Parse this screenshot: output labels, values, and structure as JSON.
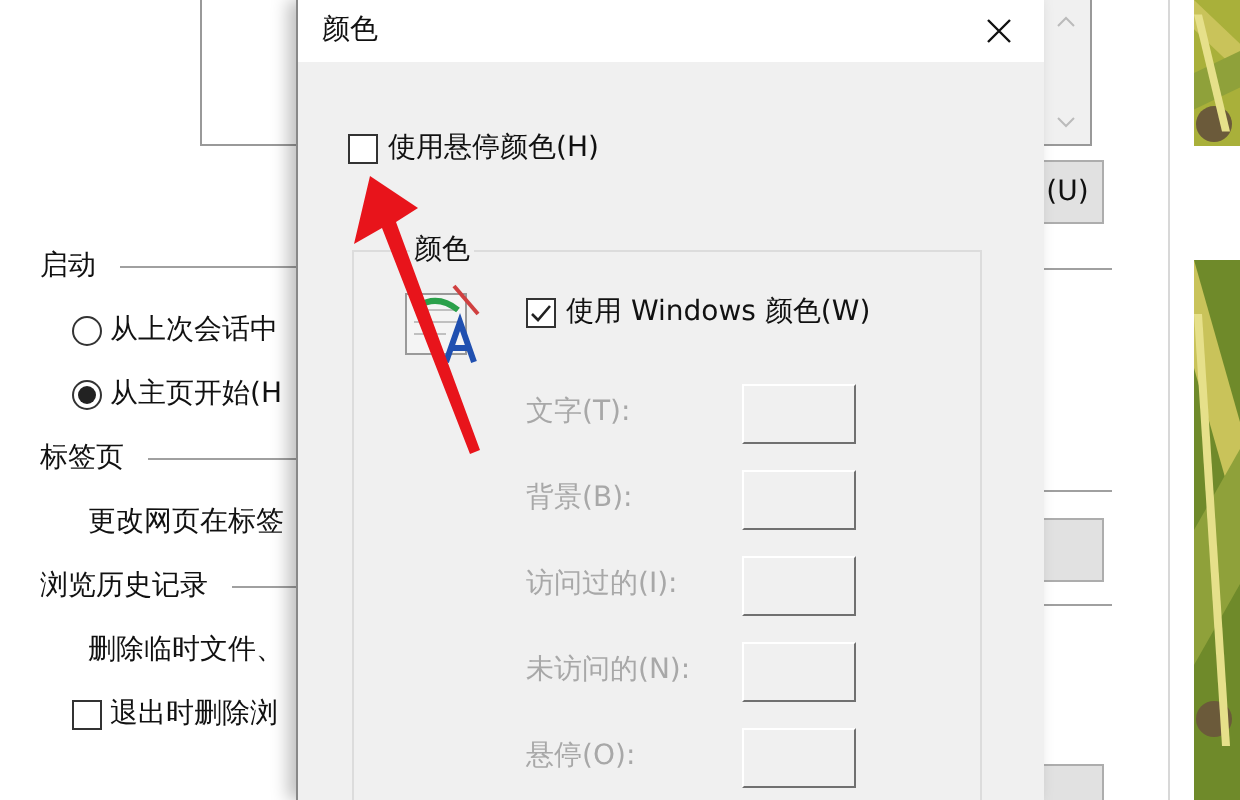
{
  "background_window": {
    "side_button": "(U)",
    "sections": [
      {
        "title": "启动",
        "items": [
          {
            "kind": "radio",
            "label": "从上次会话中",
            "selected": false
          },
          {
            "kind": "radio",
            "label": "从主页开始(H",
            "selected": true
          }
        ]
      },
      {
        "title": "标签页",
        "items": [
          {
            "kind": "text",
            "label": "更改网页在标签"
          }
        ]
      },
      {
        "title": "浏览历史记录",
        "items": [
          {
            "kind": "text",
            "label": "删除临时文件、"
          },
          {
            "kind": "checkbox",
            "label": "退出时删除浏",
            "checked": false
          }
        ]
      }
    ]
  },
  "dialog": {
    "title": "颜色",
    "hover_checkbox": {
      "label": "使用悬停颜色(H)",
      "checked": false
    },
    "group": {
      "legend": "颜色",
      "windows_colors": {
        "label": "使用 Windows 颜色(W)",
        "checked": true
      },
      "rows": [
        {
          "label": "文字(T):",
          "disabled": true
        },
        {
          "label": "背景(B):",
          "disabled": true
        },
        {
          "label": "访问过的(I):",
          "disabled": true
        },
        {
          "label": "未访问的(N):",
          "disabled": true
        },
        {
          "label": "悬停(O):",
          "disabled": true
        }
      ]
    }
  }
}
